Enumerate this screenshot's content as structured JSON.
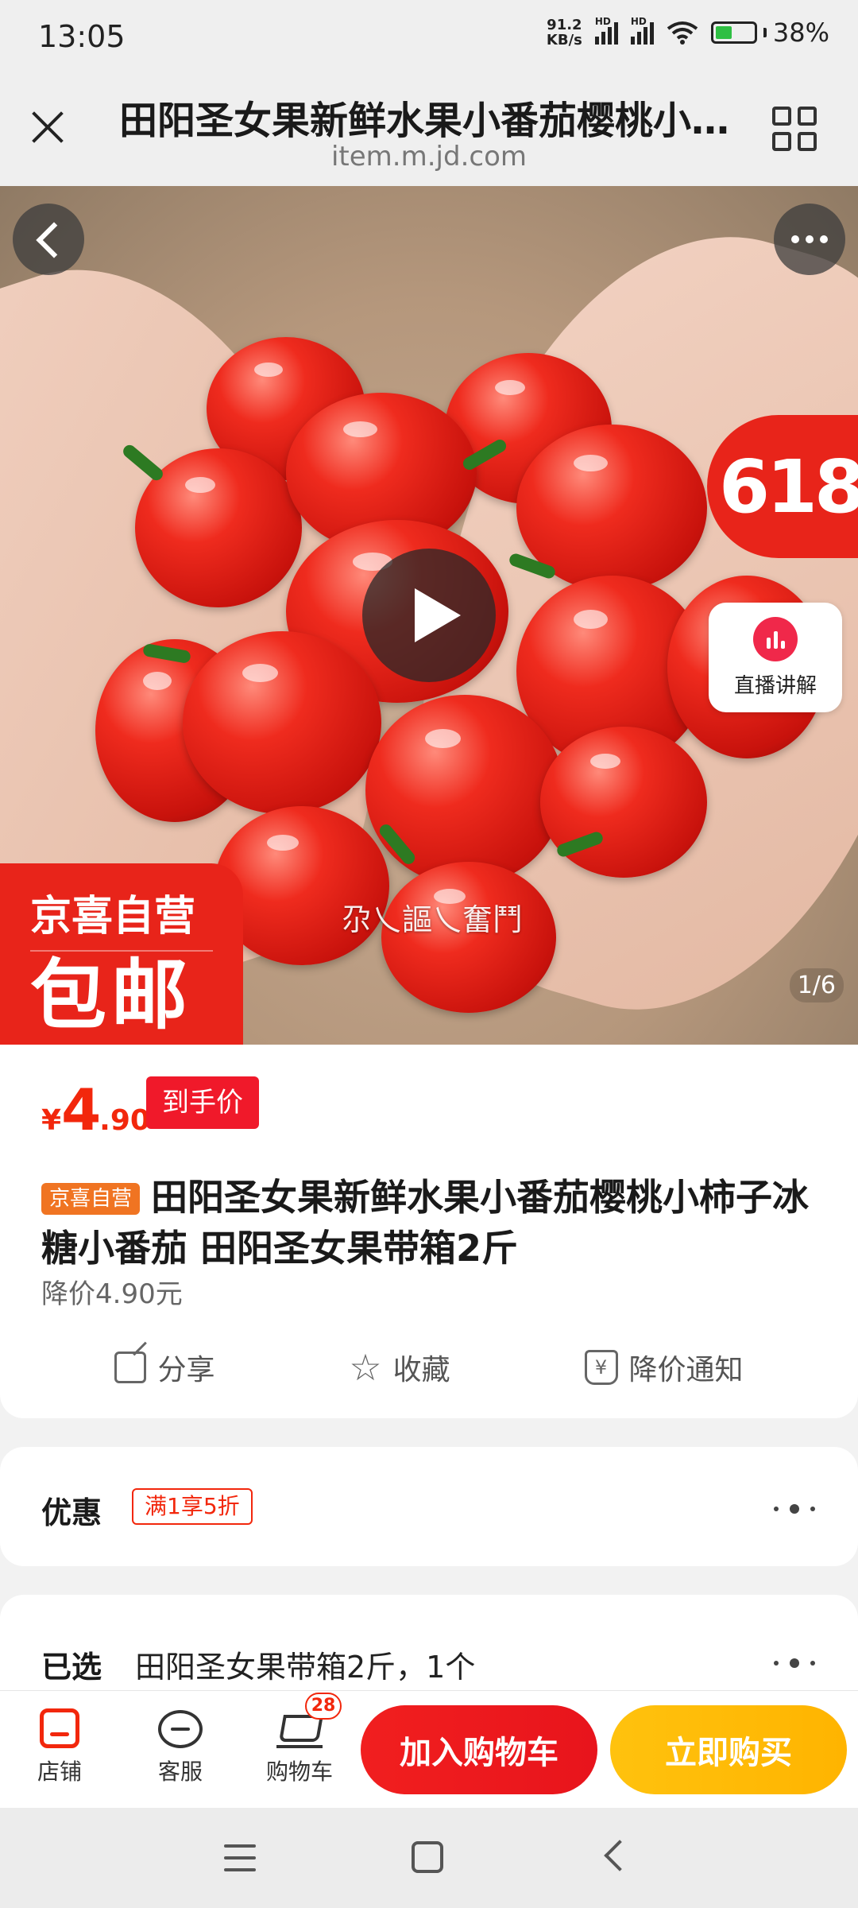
{
  "status_bar": {
    "time": "13:05",
    "net_speed_value": "91.2",
    "net_speed_unit": "KB/s",
    "signal_label": "HD",
    "battery": "38%"
  },
  "header": {
    "title": "田阳圣女果新鲜水果小番茄樱桃小柿子冰糖小番茄 田阳圣女果带箱2斤",
    "url": "item.m.jd.com"
  },
  "hero": {
    "badge_618": "618",
    "live_label": "直播讲解",
    "tag_top": "京喜自营",
    "tag_bottom": "包邮",
    "watermark": "尕乀謳乀奮鬥",
    "counter": "1/6"
  },
  "product": {
    "price_symbol": "¥",
    "price_int": "4",
    "price_dec": ".90",
    "price_tag": "到手价",
    "self_tag": "京喜自营",
    "title": "田阳圣女果新鲜水果小番茄樱桃小柿子冰糖小番茄 田阳圣女果带箱2斤",
    "price_reduce": "降价4.90元",
    "actions": {
      "share": "分享",
      "favorite": "收藏",
      "price_alert": "降价通知",
      "price_alert_icon_glyph": "¥"
    }
  },
  "discount": {
    "label": "优惠",
    "tag": "满1享5折"
  },
  "selected": {
    "label": "已选",
    "value": "田阳圣女果带箱2斤，1个"
  },
  "bottom_bar": {
    "shop": "店铺",
    "service": "客服",
    "cart": "购物车",
    "cart_count": "28",
    "add_to_cart": "加入购物车",
    "buy_now": "立即购买"
  },
  "colors": {
    "jd_red": "#f2270c",
    "buy_yellow": "#ffb400",
    "self_tag_orange": "#f07422"
  }
}
